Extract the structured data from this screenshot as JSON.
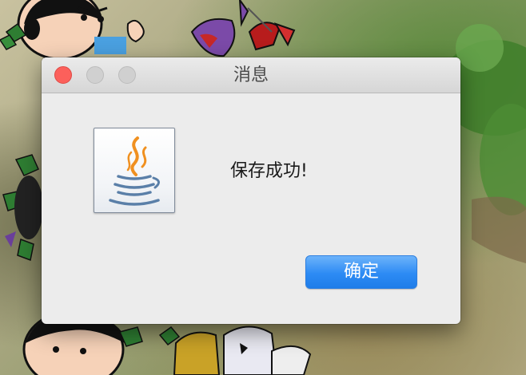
{
  "dialog": {
    "title": "消息",
    "message": "保存成功!",
    "ok_label": "确定",
    "icon": "java-coffee-cup-icon"
  },
  "window_controls": {
    "close_color": "#fc605b",
    "inactive_color": "#d0d0d0"
  },
  "accent_color": "#2d8bf4"
}
